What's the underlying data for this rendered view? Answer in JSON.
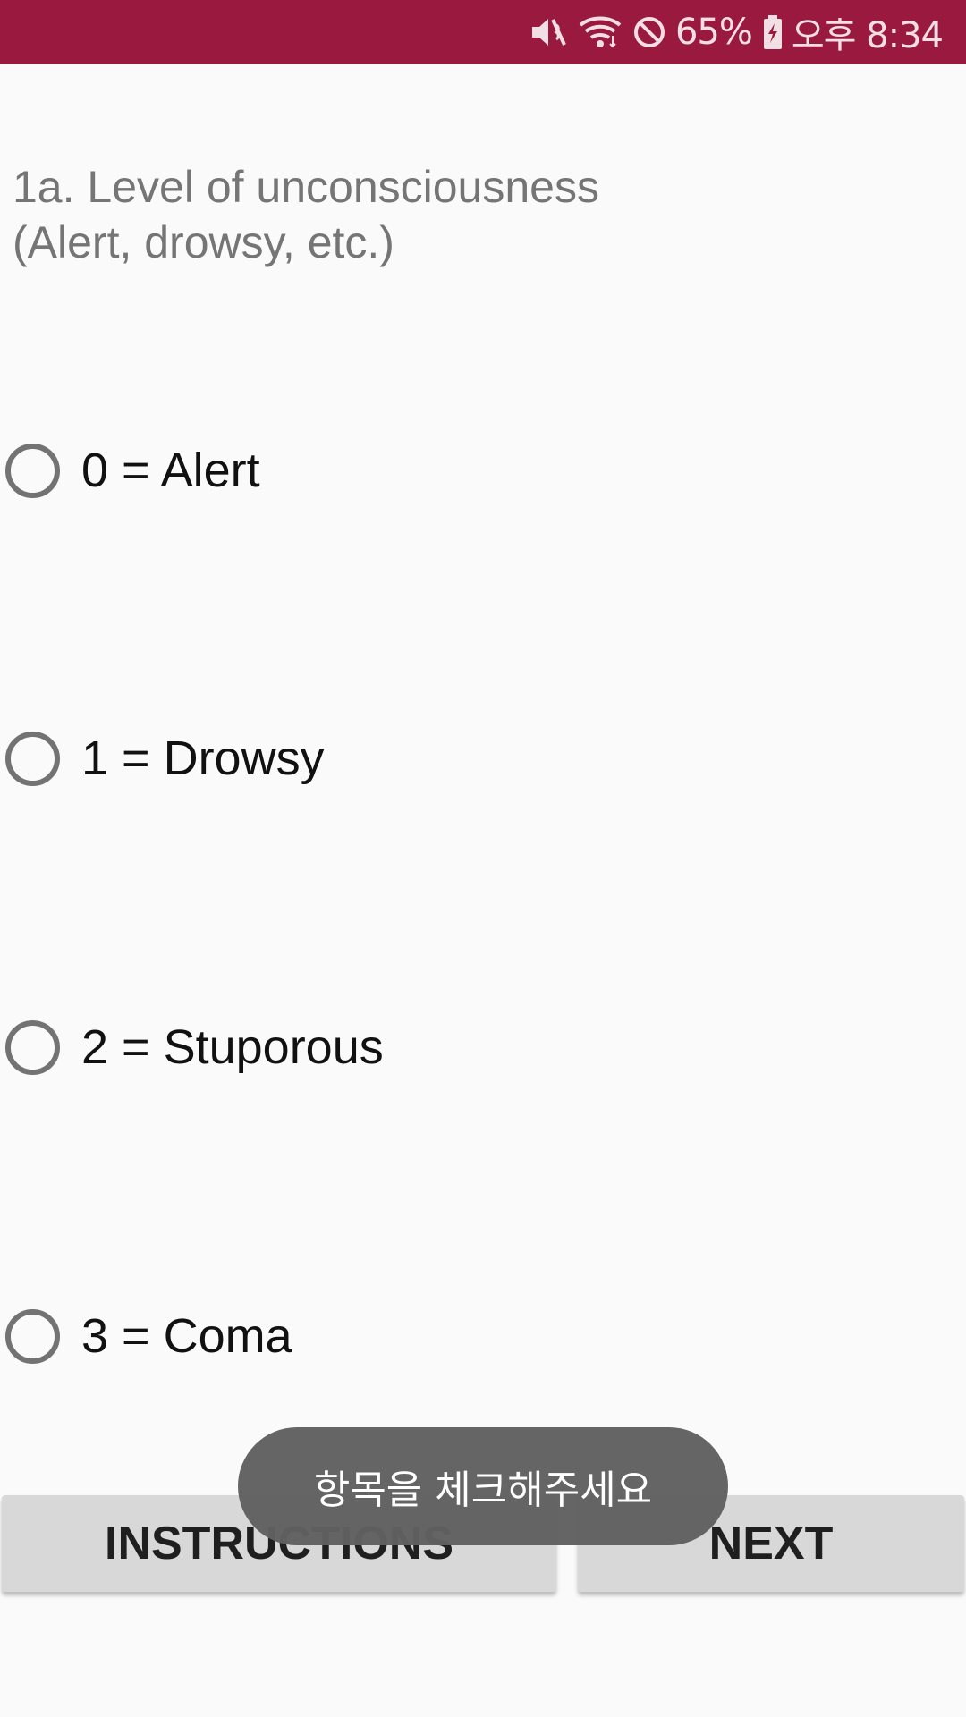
{
  "status_bar": {
    "background_color": "#9a1a3f",
    "icons": [
      "mute-vibrate-icon",
      "wifi-icon",
      "do-not-disturb-icon",
      "battery-charging-icon"
    ],
    "battery_percent": "65%",
    "time": "오후 8:34"
  },
  "question": {
    "line1": "1a. Level of unconsciousness",
    "line2": "(Alert, drowsy, etc.)"
  },
  "options": [
    {
      "label": "0 = Alert",
      "checked": false
    },
    {
      "label": "1 = Drowsy",
      "checked": false
    },
    {
      "label": "2 = Stuporous",
      "checked": false
    },
    {
      "label": "3 = Coma",
      "checked": false
    }
  ],
  "buttons": {
    "instructions_label": "INSTRUCTIONS",
    "next_label": "NEXT"
  },
  "toast": {
    "message": "항목을 체크해주세요"
  }
}
